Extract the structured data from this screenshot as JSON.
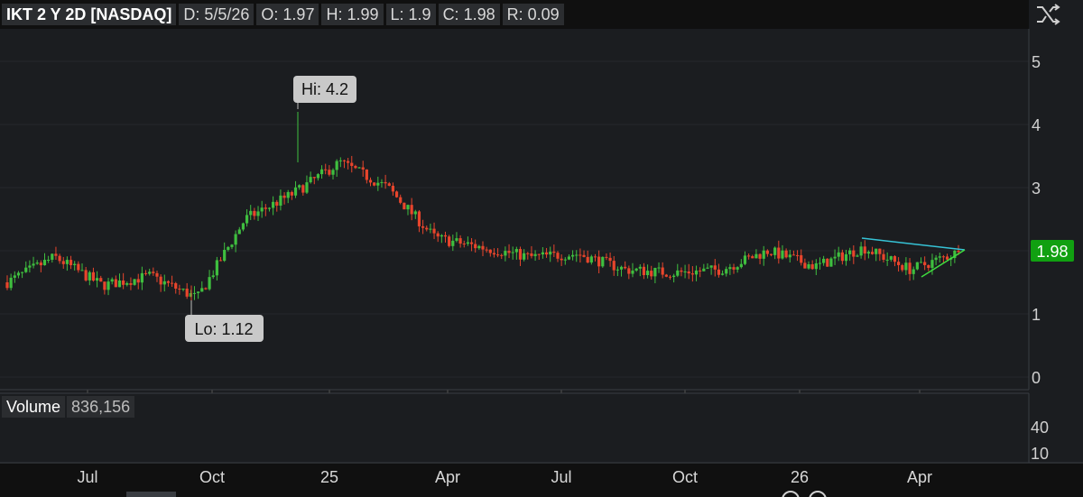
{
  "header": {
    "title": "IKT 2 Y 2D [NASDAQ]",
    "date": "D: 5/5/26",
    "open": "O: 1.97",
    "high": "H: 1.99",
    "low": "L: 1.9",
    "close": "C: 1.98",
    "range": "R: 0.09"
  },
  "toolbar": {
    "icon": "crosshair-toggle-icon"
  },
  "annotations": {
    "hi": "Hi: 4.2",
    "lo": "Lo: 1.12",
    "last_price": "1.98"
  },
  "volume_panel": {
    "label": "Volume",
    "value": "836,156",
    "y_ticks": [
      "40",
      "10"
    ]
  },
  "price_axis": {
    "ticks": [
      "5",
      "4",
      "3",
      "2",
      "1",
      "0"
    ]
  },
  "time_axis": {
    "ticks": [
      "Jul",
      "Oct",
      "25",
      "Apr",
      "Jul",
      "Oct",
      "26",
      "Apr"
    ]
  },
  "colors": {
    "up": "#3fbf3f",
    "down": "#e8452c",
    "background": "#1b1d20",
    "grid": "#2a2d31",
    "resistance": "#36c3d6",
    "support": "#3fdc3f",
    "last_price_tag": "#11a011"
  },
  "chart_data": {
    "type": "candlestick",
    "title": "IKT 2 Y 2D [NASDAQ]",
    "ylim": [
      0,
      5.6
    ],
    "yticks": [
      0,
      1,
      2,
      3,
      4,
      5
    ],
    "period": "2Y, 2-day bars",
    "last_bar": {
      "date": "5/5/26",
      "open": 1.97,
      "high": 1.99,
      "low": 1.9,
      "close": 1.98,
      "range": 0.09
    },
    "high": 4.2,
    "low": 1.12,
    "last_price": 1.98,
    "volume": 836156,
    "approx_close_path": [
      {
        "x": "May 24",
        "y": 1.5
      },
      {
        "x": "Jun 24",
        "y": 1.9
      },
      {
        "x": "Jul 24",
        "y": 1.45
      },
      {
        "x": "Aug 24",
        "y": 1.6
      },
      {
        "x": "Sep 24",
        "y": 1.25
      },
      {
        "x": "Oct 24",
        "y": 2.5
      },
      {
        "x": "Nov 24",
        "y": 2.9
      },
      {
        "x": "Dec 24",
        "y": 3.4
      },
      {
        "x": "Jan 25",
        "y": 3.0
      },
      {
        "x": "Feb 25",
        "y": 2.2
      },
      {
        "x": "Mar 25",
        "y": 2.05
      },
      {
        "x": "Apr 25",
        "y": 1.9
      },
      {
        "x": "Jun 25",
        "y": 1.95
      },
      {
        "x": "Aug 25",
        "y": 1.7
      },
      {
        "x": "Oct 25",
        "y": 1.65
      },
      {
        "x": "Dec 25",
        "y": 1.7
      },
      {
        "x": "Jan 26",
        "y": 2.0
      },
      {
        "x": "Feb 26",
        "y": 1.75
      },
      {
        "x": "Mar 26",
        "y": 2.05
      },
      {
        "x": "Apr 26",
        "y": 1.7
      },
      {
        "x": "May 26",
        "y": 1.98
      }
    ]
  }
}
